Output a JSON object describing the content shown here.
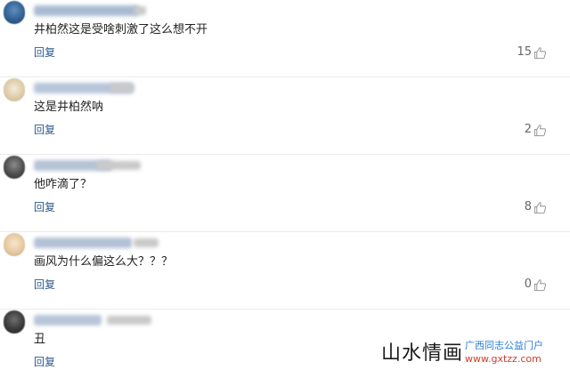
{
  "comments": [
    {
      "text": "井柏然这是受啥刺激了这么想不开",
      "reply_label": "回复",
      "likes": "15"
    },
    {
      "text": "这是井柏然呐",
      "reply_label": "回复",
      "likes": "2"
    },
    {
      "text": "他咋滴了？",
      "reply_label": "回复",
      "likes": "8"
    },
    {
      "text": "画风为什么偏这么大？？？",
      "reply_label": "回复",
      "likes": "0"
    },
    {
      "text": "丑",
      "reply_label": "回复",
      "likes": ""
    }
  ],
  "watermark": {
    "main": "山水情画",
    "site_name": "广西同志公益门户",
    "url": "www.gxtzz.com"
  },
  "colors": {
    "reply_link": "#2c5a8f",
    "watermark_blue": "#2a7fd4",
    "watermark_red": "#d23b2a"
  },
  "icons": [
    "thumbs-up-icon",
    "avatar-icon"
  ]
}
